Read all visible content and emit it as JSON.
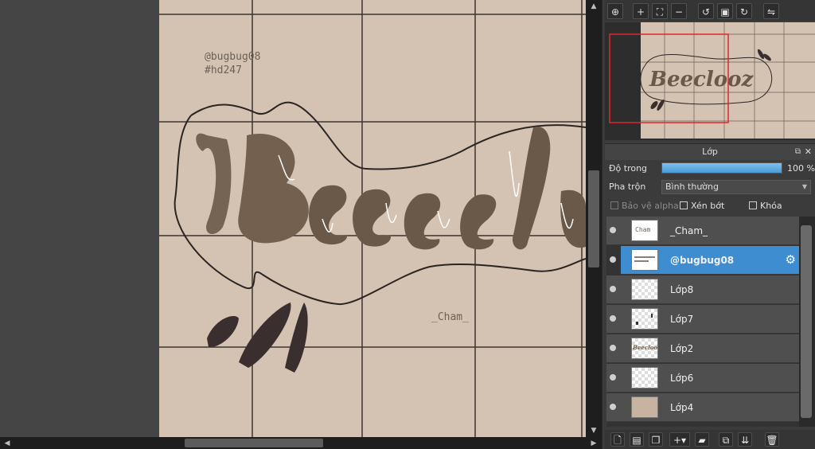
{
  "canvas": {
    "credit_handle": "@bugbug08",
    "credit_tag": "#hd247",
    "signature": "_Cham_",
    "artwork_text": "Beeclooz"
  },
  "navigator": {
    "tools": [
      "zoom-actual-icon",
      "zoom-in-icon",
      "fit-window-icon",
      "zoom-out-icon",
      "rotate-left-icon",
      "fit-screen-icon",
      "rotate-right-icon",
      "flip-horizontal-icon"
    ],
    "preview_text": "Beeclooz"
  },
  "layers_panel": {
    "title": "Lớp",
    "opacity_label": "Độ trong",
    "opacity_value": "100 %",
    "opacity_fraction": 1.0,
    "blend_label": "Pha trộn",
    "blend_value": "Bình thường",
    "protect_alpha_label": "Bảo vệ alpha",
    "clipping_label": "Xén bớt",
    "lock_label": "Khóa",
    "layers": [
      {
        "name": "_Cham_",
        "thumb": "Cham"
      },
      {
        "name": "@bugbug08",
        "thumb": "text"
      },
      {
        "name": "Lớp8",
        "thumb": "empty"
      },
      {
        "name": "Lớp7",
        "thumb": "marks"
      },
      {
        "name": "Lớp2",
        "thumb": "Beeclooz"
      },
      {
        "name": "Lớp6",
        "thumb": "empty"
      },
      {
        "name": "Lớp4",
        "thumb": "fill"
      }
    ],
    "selected_layer": "@bugbug08",
    "bottom_tools": [
      "new-layer-icon",
      "new-layer-from-file-icon",
      "new-layer-copy-icon",
      "add-layer-menu-icon",
      "new-folder-icon",
      "duplicate-layer-icon",
      "merge-layer-icon",
      "delete-layer-icon"
    ]
  },
  "colors": {
    "canvas_bg": "#d4c2b2",
    "letter_fill": "#72604f",
    "selection_blue": "#3d8dd0",
    "navigator_frame": "#e0262b"
  }
}
